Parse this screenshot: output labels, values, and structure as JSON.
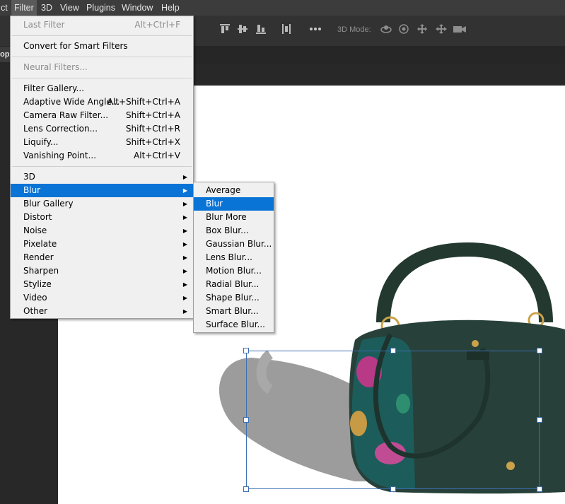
{
  "menubar": {
    "items": [
      "ct",
      "Filter",
      "3D",
      "View",
      "Plugins",
      "Window",
      "Help"
    ],
    "active": "Filter"
  },
  "optionsbar": {
    "mode_label": "3D Mode:"
  },
  "document_tab": {
    "label": "op"
  },
  "filter_menu": {
    "last_filter": {
      "label": "Last Filter",
      "shortcut": "Alt+Ctrl+F"
    },
    "convert_smart": {
      "label": "Convert for Smart Filters"
    },
    "neural_filters": {
      "label": "Neural Filters..."
    },
    "filter_gallery": {
      "label": "Filter Gallery..."
    },
    "adaptive_wide": {
      "label": "Adaptive Wide Angle...",
      "shortcut": "Alt+Shift+Ctrl+A"
    },
    "camera_raw": {
      "label": "Camera Raw Filter...",
      "shortcut": "Shift+Ctrl+A"
    },
    "lens_correction": {
      "label": "Lens Correction...",
      "shortcut": "Shift+Ctrl+R"
    },
    "liquify": {
      "label": "Liquify...",
      "shortcut": "Shift+Ctrl+X"
    },
    "vanishing_point": {
      "label": "Vanishing Point...",
      "shortcut": "Alt+Ctrl+V"
    },
    "submenus": [
      "3D",
      "Blur",
      "Blur Gallery",
      "Distort",
      "Noise",
      "Pixelate",
      "Render",
      "Sharpen",
      "Stylize",
      "Video",
      "Other"
    ],
    "highlighted": "Blur"
  },
  "blur_submenu": {
    "items": [
      "Average",
      "Blur",
      "Blur More",
      "Box Blur...",
      "Gaussian Blur...",
      "Lens Blur...",
      "Motion Blur...",
      "Radial Blur...",
      "Shape Blur...",
      "Smart Blur...",
      "Surface Blur..."
    ],
    "highlighted": "Blur"
  },
  "colors": {
    "menu_highlight": "#0a74d6",
    "menubar_bg": "#3c3c3c",
    "canvas_bg": "#ffffff",
    "bag_leather": "#27403a",
    "selection_border": "#3d6fb3"
  },
  "icons": [
    "align-top-icon",
    "align-vcenter-icon",
    "align-bottom-icon",
    "distribute-icon",
    "more-options-icon",
    "3d-orbit-icon",
    "3d-roll-icon",
    "3d-drag-icon",
    "3d-slide-icon",
    "3d-camera-icon"
  ]
}
